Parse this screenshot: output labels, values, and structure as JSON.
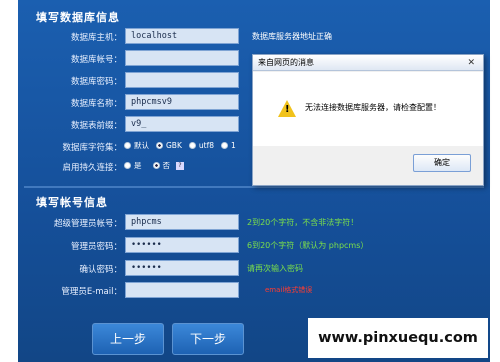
{
  "db_section": {
    "title": "填写数据库信息",
    "host_label": "数据库主机：",
    "host_value": "localhost",
    "host_hint": "数据库服务器地址正确",
    "user_label": "数据库帐号：",
    "user_value": "",
    "password_label": "数据库密码：",
    "password_value": "",
    "name_label": "数据库名称：",
    "name_value": "phpcmsv9",
    "prefix_label": "数据表前缀：",
    "prefix_value": "v9_",
    "charset_label": "数据库字符集：",
    "charset_options": [
      "默认",
      "GBK",
      "utf8",
      "1"
    ],
    "charset_selected": "GBK",
    "persistent_label": "启用持久连接：",
    "persistent_options": [
      "是",
      "否"
    ],
    "persistent_selected": "否"
  },
  "account_section": {
    "title": "填写帐号信息",
    "admin_label": "超级管理员帐号：",
    "admin_value": "phpcms",
    "admin_hint": "2到20个字符，不含非法字符！",
    "pwd_label": "管理员密码：",
    "pwd_value": "••••••",
    "pwd_hint": "6到20个字符（默认为 phpcms）",
    "confirm_label": "确认密码：",
    "confirm_value": "••••••",
    "confirm_hint": "请再次输入密码",
    "email_label": "管理员E-mail：",
    "email_value": "",
    "email_hint": "email格式错误"
  },
  "buttons": {
    "prev": "上一步",
    "next": "下一步"
  },
  "dialog": {
    "title": "来自网页的消息",
    "close": "✕",
    "message": "无法连接数据库服务器，请检查配置！",
    "ok": "确定",
    "icon": "warning-icon"
  },
  "watermark": "www.pinxuequ.com",
  "colors": {
    "panel": "#1b5fb0",
    "hint_green": "#7be04a",
    "hint_red": "#ff3b30"
  }
}
